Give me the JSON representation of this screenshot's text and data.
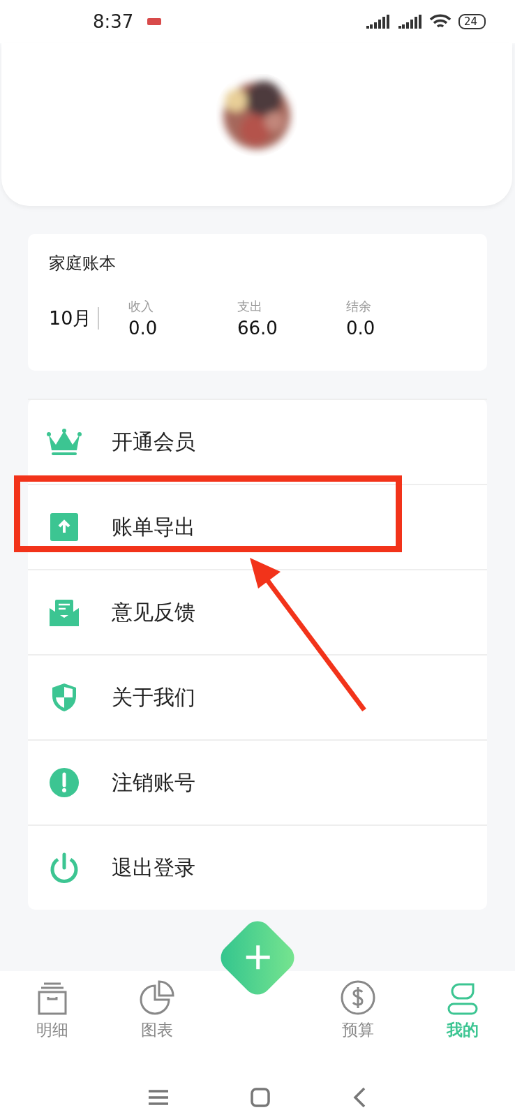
{
  "status_bar": {
    "time": "8:37",
    "battery": "24"
  },
  "ledger": {
    "title": "家庭账本",
    "month": "10月",
    "stats": [
      {
        "label": "收入",
        "value": "0.0"
      },
      {
        "label": "支出",
        "value": "66.0"
      },
      {
        "label": "结余",
        "value": "0.0"
      }
    ]
  },
  "menu": [
    {
      "kind": "crown",
      "label": "开通会员"
    },
    {
      "kind": "export",
      "label": "账单导出"
    },
    {
      "kind": "feedback",
      "label": "意见反馈"
    },
    {
      "kind": "shield",
      "label": "关于我们"
    },
    {
      "kind": "alert",
      "label": "注销账号"
    },
    {
      "kind": "power",
      "label": "退出登录"
    }
  ],
  "tabs": [
    {
      "kind": "box",
      "label": "明细",
      "selected": false
    },
    {
      "kind": "pie",
      "label": "图表",
      "selected": false
    },
    {
      "kind": "add"
    },
    {
      "kind": "dollar",
      "label": "预算",
      "selected": false
    },
    {
      "kind": "person",
      "label": "我的",
      "selected": true
    }
  ]
}
